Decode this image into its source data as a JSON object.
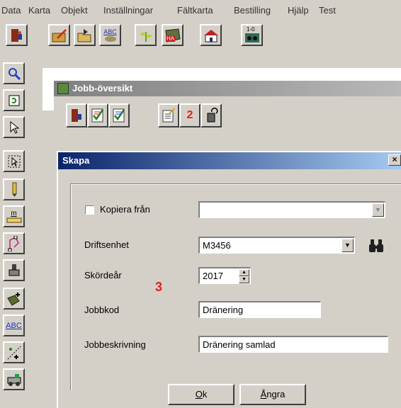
{
  "menu": [
    "Data",
    "Karta",
    "Objekt",
    "Inställningar",
    "Fältkarta",
    "Bestilling",
    "Hjälp",
    "Test"
  ],
  "top_toolbar": {
    "abc_label": "ABC",
    "ha_label": "HA",
    "one_zero_label": "1-0"
  },
  "left_toolbar": {
    "m_label": "m",
    "abc_label": "ABC"
  },
  "jobb_window": {
    "title": "Jobb-översikt",
    "two_label": "2"
  },
  "skapa_dialog": {
    "title": "Skapa",
    "close_label": "×",
    "kopiera_label": "Kopiera från",
    "kopiera_value": "",
    "driftsenhet_label": "Driftsenhet",
    "driftsenhet_value": "M3456",
    "skordear_label": "Skördeår",
    "skordear_value": "2017",
    "jobbkod_label": "Jobbkod",
    "jobbkod_value": "Dränering",
    "jobbeskrivning_label": "Jobbeskrivning",
    "jobbeskrivning_value": "Dränering samlad",
    "annotation": "3",
    "ok_rest": "k",
    "ok_mnemonic": "O",
    "angra_mnemonic": "Å",
    "angra_rest": "ngra"
  }
}
